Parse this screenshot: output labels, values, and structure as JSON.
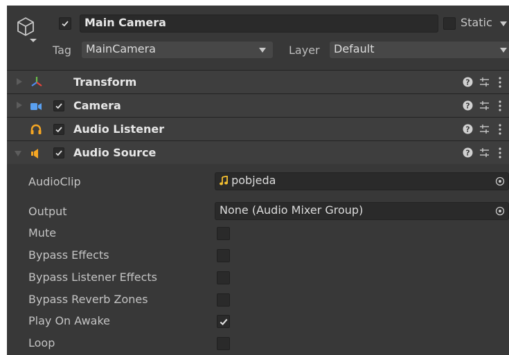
{
  "header": {
    "object_name": "Main Camera",
    "active": true,
    "static_label": "Static",
    "static_checked": false,
    "tag_label": "Tag",
    "tag_value": "MainCamera",
    "layer_label": "Layer",
    "layer_value": "Default"
  },
  "components": [
    {
      "title": "Transform",
      "icon": "transform-axes-icon",
      "expanded": false,
      "has_toggle": false
    },
    {
      "title": "Camera",
      "icon": "camera-icon",
      "expanded": false,
      "has_toggle": true,
      "enabled": true
    },
    {
      "title": "Audio Listener",
      "icon": "headphones-icon",
      "expanded": false,
      "has_toggle": true,
      "enabled": true
    },
    {
      "title": "Audio Source",
      "icon": "speaker-icon",
      "expanded": true,
      "has_toggle": true,
      "enabled": true
    }
  ],
  "audio_source": {
    "audioclip_label": "AudioClip",
    "audioclip_value": "pobjeda",
    "output_label": "Output",
    "output_value": "None (Audio Mixer Group)",
    "toggles": [
      {
        "label": "Mute",
        "checked": false
      },
      {
        "label": "Bypass Effects",
        "checked": false
      },
      {
        "label": "Bypass Listener Effects",
        "checked": false
      },
      {
        "label": "Bypass Reverb Zones",
        "checked": false
      },
      {
        "label": "Play On Awake",
        "checked": true
      },
      {
        "label": "Loop",
        "checked": false
      }
    ]
  },
  "colors": {
    "panel_bg": "#383838",
    "header_bg": "#3e3e3e",
    "field_bg": "#2a2a2a",
    "audio_icon": "#f5a623",
    "camera_icon": "#5aa0f0"
  }
}
